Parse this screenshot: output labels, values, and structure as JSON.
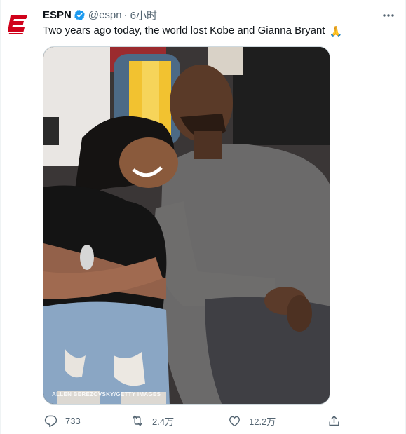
{
  "tweet": {
    "author": {
      "display_name": "ESPN",
      "handle": "@espn",
      "verified": true,
      "avatar_icon": "espn-logo-icon",
      "brand_color": "#d0021b"
    },
    "separator": "·",
    "timestamp": "6小时",
    "text": "Two years ago today, the world lost Kobe and Gianna Bryant",
    "emoji": "🙏",
    "media": {
      "photo_credit": "ALLEN BEREZOVSKY/GETTY IMAGES"
    },
    "actions": {
      "reply": {
        "icon": "reply-icon",
        "count": "733"
      },
      "retweet": {
        "icon": "retweet-icon",
        "count": "2.4万"
      },
      "like": {
        "icon": "heart-icon",
        "count": "12.2万"
      },
      "share": {
        "icon": "share-icon"
      }
    }
  },
  "colors": {
    "text_primary": "#0f1419",
    "text_secondary": "#536471",
    "verified_blue": "#1d9bf0"
  }
}
